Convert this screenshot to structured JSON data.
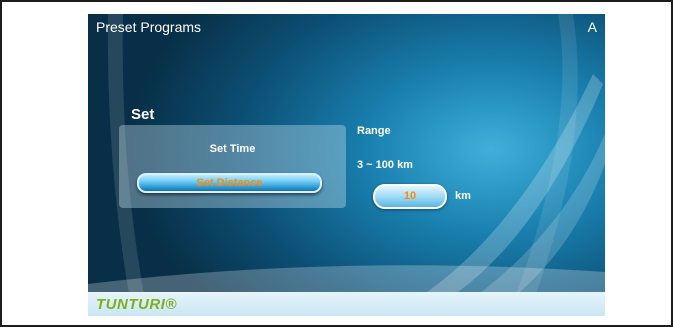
{
  "header": {
    "title": "Preset Programs",
    "corner_label": "A"
  },
  "set_panel": {
    "heading": "Set",
    "options": [
      {
        "label": "Set Time",
        "selected": false
      },
      {
        "label": "Set Distance",
        "selected": true
      }
    ]
  },
  "range": {
    "label": "Range",
    "text": "3 ~ 100 km",
    "input_value": "10",
    "unit": "km"
  },
  "footer": {
    "logo_text": "TUNTURI®"
  },
  "colors": {
    "accent_orange": "#ff8a00",
    "logo_green": "#7fae1f",
    "background_blue": "#197fae"
  }
}
